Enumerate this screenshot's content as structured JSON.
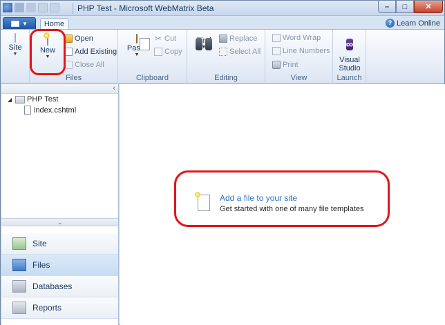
{
  "window": {
    "title": "PHP Test - Microsoft WebMatrix Beta"
  },
  "tabs": {
    "home": "Home",
    "learn_online": "Learn Online"
  },
  "ribbon": {
    "site_group": {
      "site_label": "Site"
    },
    "files_group": {
      "label": "Files",
      "new": "New",
      "open": "Open",
      "add_existing": "Add Existing",
      "close_all": "Close All"
    },
    "clipboard_group": {
      "label": "Clipboard",
      "paste": "Paste",
      "cut": "Cut",
      "copy": "Copy"
    },
    "editing_group": {
      "label": "Editing",
      "find": "Find",
      "replace": "Replace",
      "select_all": "Select All"
    },
    "view_group": {
      "label": "View",
      "word_wrap": "Word Wrap",
      "line_numbers": "Line Numbers",
      "print": "Print"
    },
    "launch_group": {
      "label": "Launch",
      "visual_studio": "Visual Studio"
    }
  },
  "tree": {
    "root": "PHP Test",
    "files": [
      "index.cshtml"
    ]
  },
  "nav": {
    "items": [
      {
        "label": "Site",
        "icon": "site-icon"
      },
      {
        "label": "Files",
        "icon": "files-icon",
        "active": true
      },
      {
        "label": "Databases",
        "icon": "databases-icon"
      },
      {
        "label": "Reports",
        "icon": "reports-icon"
      }
    ]
  },
  "main": {
    "add_file_link": "Add a file to your site",
    "add_file_desc": "Get started with one of many file templates"
  },
  "colors": {
    "accent": "#2b74c7",
    "highlight": "#e0161b",
    "ribbon_bg": "#e6edf7"
  }
}
